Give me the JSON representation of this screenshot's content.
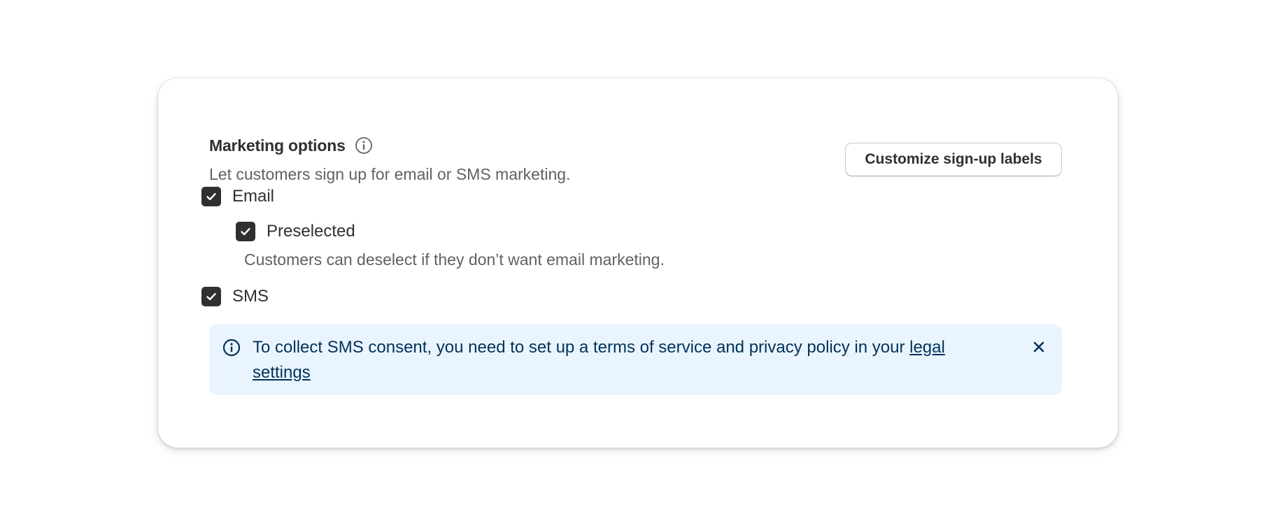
{
  "section": {
    "title": "Marketing options",
    "subtitle": "Let customers sign up for email or SMS marketing.",
    "customize_button": "Customize sign-up labels"
  },
  "options": {
    "email": {
      "label": "Email",
      "checked": true
    },
    "preselected": {
      "label": "Preselected",
      "checked": true,
      "help": "Customers can deselect if they don’t want email marketing."
    },
    "sms": {
      "label": "SMS",
      "checked": true
    }
  },
  "banner": {
    "text": "To collect SMS consent, you need to set up a terms of service and privacy policy in your ",
    "link": "legal settings"
  },
  "icons": {
    "title_info": "info-circle-icon",
    "banner_info": "info-circle-icon",
    "checkbox": "checkmark-icon",
    "dismiss": "close-icon"
  },
  "colors": {
    "checkbox_fill": "#303030",
    "banner_background": "#eaf4ff",
    "banner_text": "#00325a",
    "title_text": "#303030",
    "secondary_text": "#616161"
  }
}
